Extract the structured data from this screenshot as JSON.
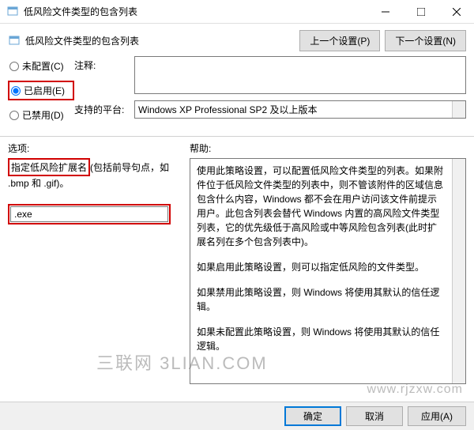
{
  "titlebar": {
    "title": "低风险文件类型的包含列表"
  },
  "top": {
    "subtitle": "低风险文件类型的包含列表",
    "prev_btn": "上一个设置(P)",
    "next_btn": "下一个设置(N)"
  },
  "radios": {
    "not_configured": "未配置(C)",
    "enabled": "已启用(E)",
    "disabled": "已禁用(D)"
  },
  "details": {
    "comment_label": "注释:",
    "comment_value": "",
    "platform_label": "支持的平台:",
    "platform_value": "Windows XP Professional SP2 及以上版本"
  },
  "mid": {
    "options_label": "选项:",
    "help_label": "帮助:"
  },
  "options": {
    "ext_label": "指定低风险扩展名",
    "ext_example": "(包括前导句点，如 .bmp 和 .gif)。",
    "ext_value": ".exe"
  },
  "help": {
    "p1": "使用此策略设置，可以配置低风险文件类型的列表。如果附件位于低风险文件类型的列表中，则不管该附件的区域信息包含什么内容，Windows 都不会在用户访问该文件前提示用户。此包含列表会替代 Windows 内置的高风险文件类型列表，它的优先级低于高风险或中等风险包含列表(此时扩展名列在多个包含列表中)。",
    "p2": "如果启用此策略设置，则可以指定低风险的文件类型。",
    "p3": "如果禁用此策略设置，则 Windows 将使用其默认的信任逻辑。",
    "p4": "如果未配置此策略设置，则 Windows 将使用其默认的信任逻辑。"
  },
  "footer": {
    "ok": "确定",
    "cancel": "取消",
    "apply": "应用(A)"
  },
  "watermark": {
    "main": "三联网 3LIAN.COM",
    "sub": "www.rjzxw.com"
  }
}
